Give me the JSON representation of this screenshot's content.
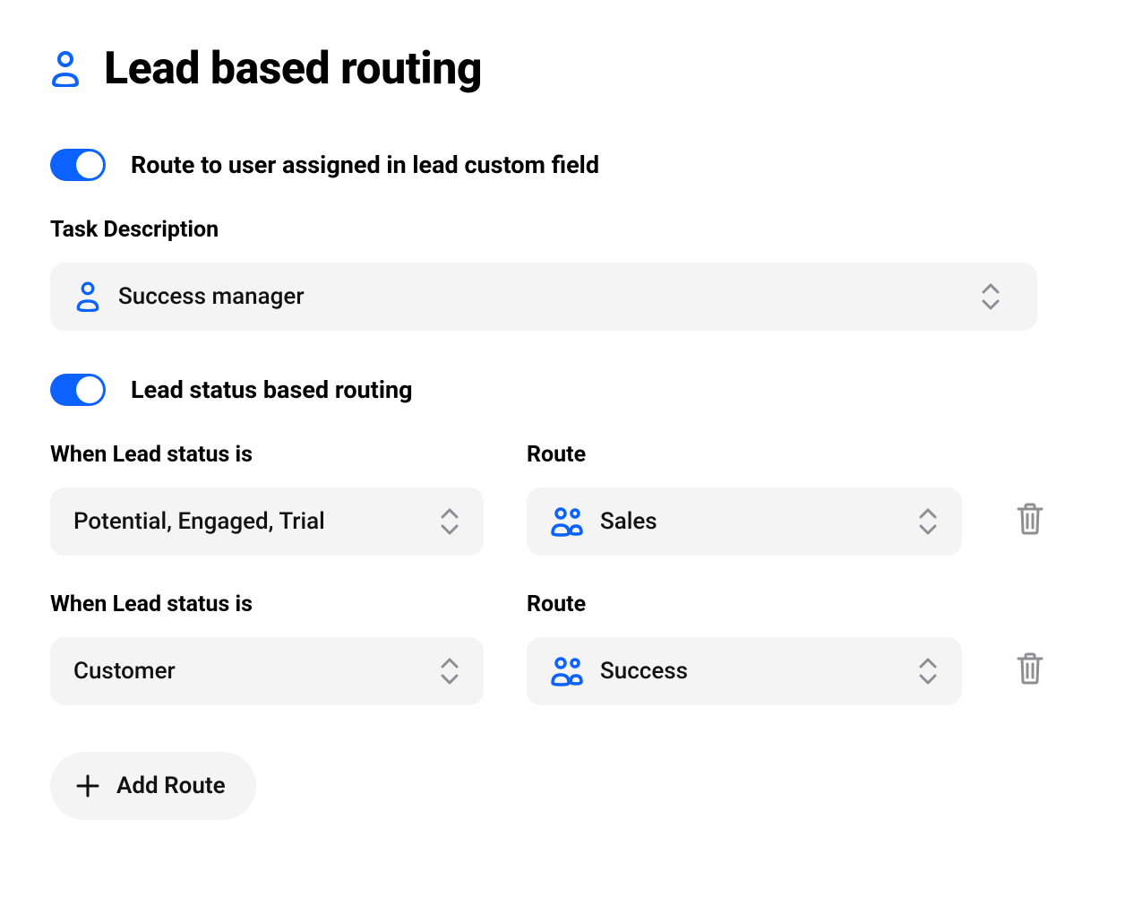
{
  "header": {
    "title": "Lead based routing"
  },
  "section1": {
    "toggle_label": "Route to user assigned in lead custom field",
    "toggle_on": true,
    "field_label": "Task Description",
    "select_value": "Success manager"
  },
  "section2": {
    "toggle_label": "Lead status based routing",
    "toggle_on": true,
    "routes": [
      {
        "when_label": "When Lead status is",
        "when_value": "Potential, Engaged, Trial",
        "route_label": "Route",
        "route_value": "Sales"
      },
      {
        "when_label": "When Lead status is",
        "when_value": "Customer",
        "route_label": "Route",
        "route_value": "Success"
      }
    ],
    "add_route_label": "Add Route"
  },
  "colors": {
    "accent": "#0b62ff",
    "pill_bg": "#f4f4f5",
    "icon_gray": "#8e8e93"
  }
}
